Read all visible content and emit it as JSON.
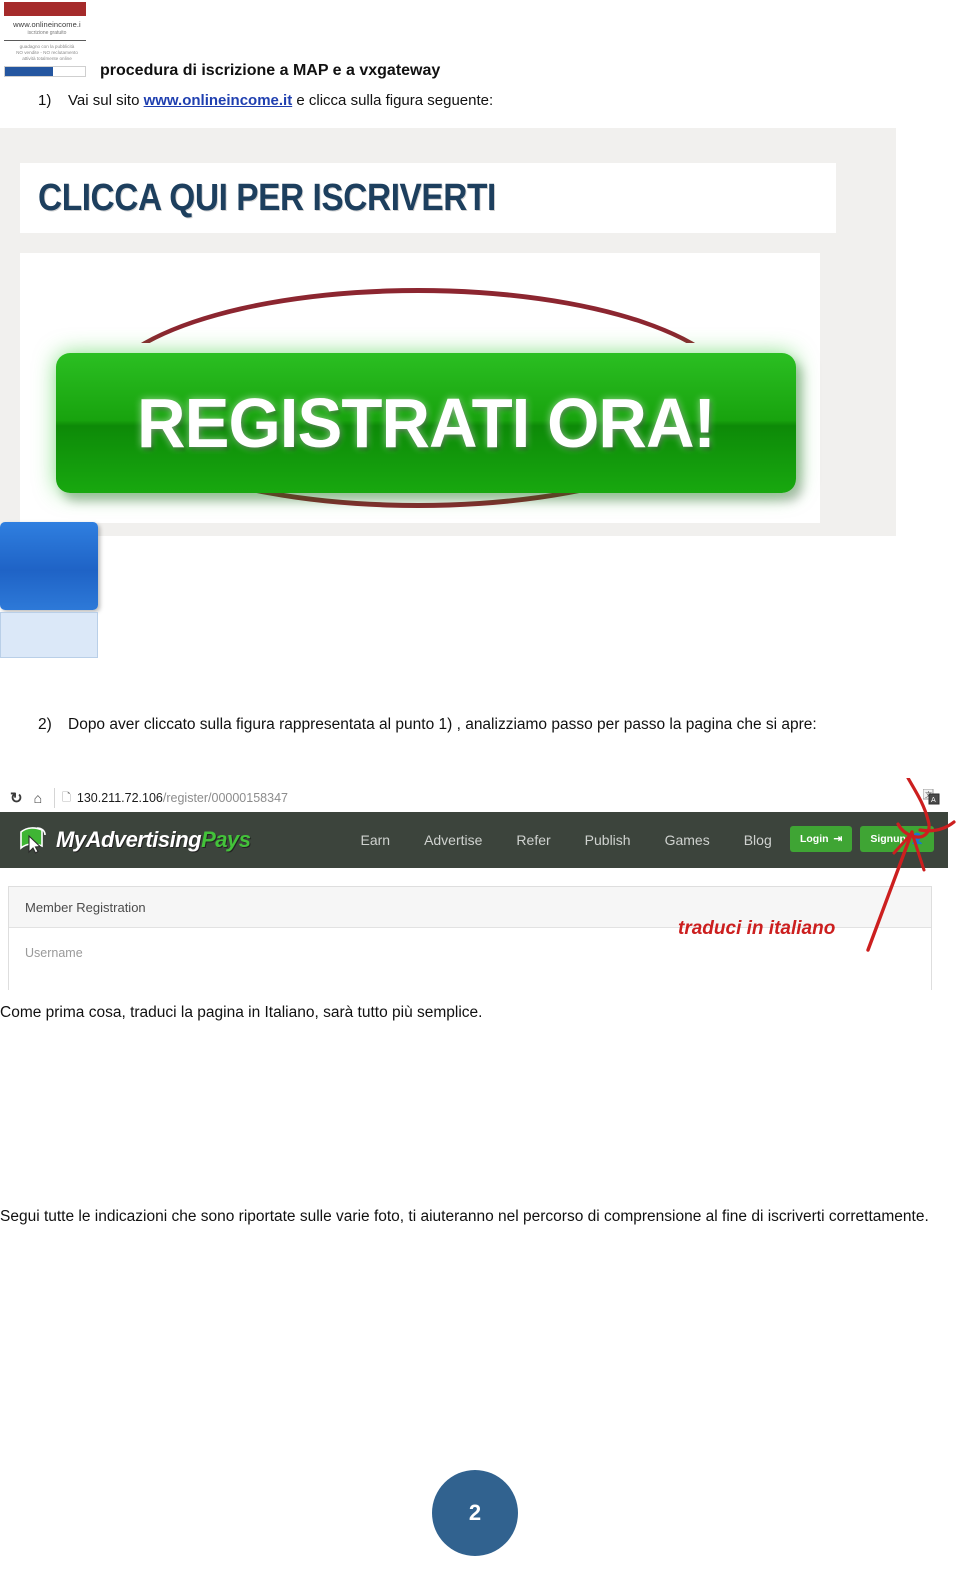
{
  "letterhead": {
    "site": "www.onlineincome.i",
    "tagline": "iscrizione gratuito",
    "lines": [
      "guadagno con la pubblicità",
      "NO vendite - NO reclutamento",
      "attività totalmente online"
    ]
  },
  "doc": {
    "title": "procedura di iscrizione a MAP e a vxgateway"
  },
  "step1": {
    "number": "1)",
    "before": "Vai sul sito ",
    "link": "www.onlineincome.it",
    "after": " e clicca sulla figura seguente:"
  },
  "advert": {
    "banner_text": "CLICCA QUI PER ISCRIVERTI",
    "button_text": "REGISTRATI ORA!"
  },
  "step2": {
    "number": "2)",
    "text": "Dopo aver cliccato sulla figura rappresentata al punto 1) , analizziamo passo per passo la pagina che si apre:"
  },
  "browser": {
    "reload_icon": "reload-icon",
    "home_icon": "home-icon",
    "page_icon": "page-icon",
    "url_domain": "130.211.72.106",
    "url_path": "/register/00000158347",
    "translate_icon": "translate-icon",
    "logo": {
      "part1": "My",
      "part2": "Advertising",
      "part3": "Pays"
    },
    "nav": [
      "Earn",
      "Advertise",
      "Refer",
      "Publish",
      "Games",
      "Blog"
    ],
    "login_label": "Login",
    "login_icon": "login-arrow-icon",
    "signup_label": "Signup",
    "signup_icon": "signup-user-icon",
    "panel_title": "Member Registration",
    "field_label": "Username"
  },
  "annotation": {
    "text": "traduci in italiano",
    "color": "#cc1f1f"
  },
  "paragraphs": {
    "come": "Come prima cosa, traduci la pagina in Italiano, sarà tutto più semplice.",
    "segui": "Segui tutte le indicazioni che sono riportate sulle varie foto, ti aiuteranno nel percorso di comprensione al fine di iscriverti correttamente."
  },
  "footer": {
    "page_number": "2"
  },
  "colors": {
    "accent_blue": "#31628f",
    "brand_green": "#3fa534",
    "nav_dark": "#3c443c",
    "annotation_red": "#cc1f1f",
    "banner_navy": "#1d3f5e"
  }
}
